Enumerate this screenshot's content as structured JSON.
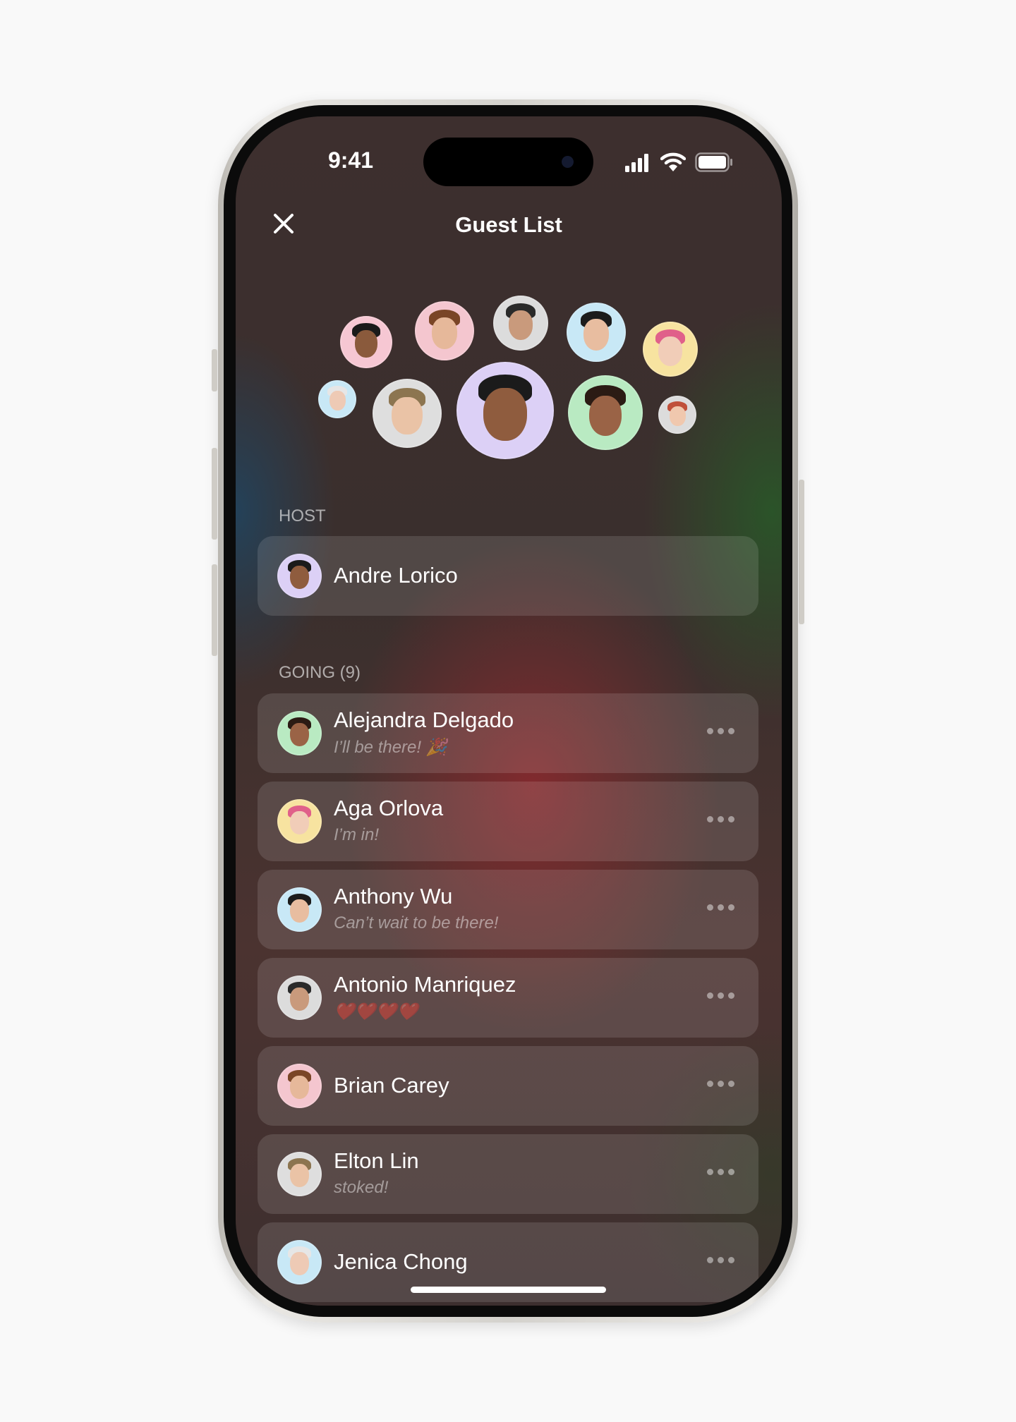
{
  "status_bar": {
    "time": "9:41",
    "icons": [
      "cellular-signal-icon",
      "wifi-icon",
      "battery-icon"
    ]
  },
  "header": {
    "title": "Guest List",
    "close_icon": "close-icon"
  },
  "avatar_cluster": [
    {
      "bg": "#f6c7d3",
      "skin": "#8a5a3c",
      "hair": "#1a1a1a"
    },
    {
      "bg": "#f4c6cf",
      "skin": "#e6b89a",
      "hair": "#7a4526"
    },
    {
      "bg": "#dcdcdc",
      "skin": "#c99a7c",
      "hair": "#2a2a2a"
    },
    {
      "bg": "#c8e8f6",
      "skin": "#e8bda0",
      "hair": "#1c1c1c"
    },
    {
      "bg": "#f7e3a0",
      "skin": "#f1cdb8",
      "hair": "#e0608a"
    },
    {
      "bg": "#c8e8f6",
      "skin": "#eecab5",
      "hair": "#e6e6e6"
    },
    {
      "bg": "#dedede",
      "skin": "#eac3a6",
      "hair": "#8c7550"
    },
    {
      "bg": "#dcd0f6",
      "skin": "#8f5c3e",
      "hair": "#1b1b1b"
    },
    {
      "bg": "#b9eac2",
      "skin": "#9a6346",
      "hair": "#2b1b14"
    },
    {
      "bg": "#dcdcdc",
      "skin": "#f0c8ae",
      "hair": "#c0503a"
    }
  ],
  "host": {
    "label": "HOST",
    "name": "Andre Lorico",
    "avatar_index": 7
  },
  "going": {
    "label": "GOING (9)",
    "guests": [
      {
        "name": "Alejandra Delgado",
        "status": "I’ll be there! 🎉",
        "avatar_index": 8
      },
      {
        "name": "Aga Orlova",
        "status": "I’m in!",
        "avatar_index": 4
      },
      {
        "name": "Anthony Wu",
        "status": "Can’t wait to be there!",
        "avatar_index": 3
      },
      {
        "name": "Antonio Manriquez",
        "status": "❤️❤️❤️❤️",
        "avatar_index": 2
      },
      {
        "name": "Brian Carey",
        "status": "",
        "avatar_index": 1
      },
      {
        "name": "Elton Lin",
        "status": "stoked!",
        "avatar_index": 6
      },
      {
        "name": "Jenica Chong",
        "status": "",
        "avatar_index": 5
      }
    ]
  },
  "more_icon": "ellipsis-icon"
}
